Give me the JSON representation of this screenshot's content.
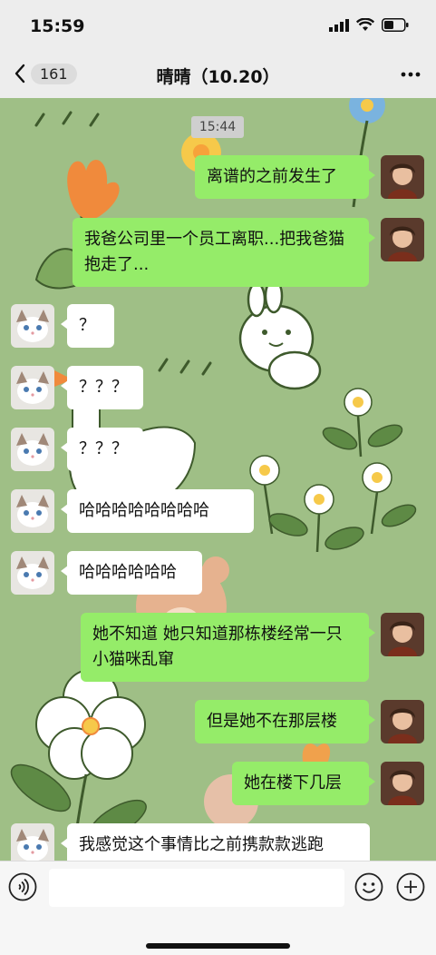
{
  "status_bar": {
    "time": "15:59"
  },
  "nav": {
    "back_count": "161",
    "title": "晴晴（10.20）"
  },
  "chat": {
    "timestamp": "15:44",
    "messages": [
      {
        "from": "me",
        "text": "离谱的之前发生了"
      },
      {
        "from": "me",
        "text": "我爸公司里一个员工离职...把我爸猫抱走了..."
      },
      {
        "from": "friend",
        "text": "？"
      },
      {
        "from": "friend",
        "text": "？？？"
      },
      {
        "from": "friend",
        "text": "？？？"
      },
      {
        "from": "friend",
        "text": "哈哈哈哈哈哈哈哈"
      },
      {
        "from": "friend",
        "text": "哈哈哈哈哈哈"
      },
      {
        "from": "me",
        "text": "她不知道 她只知道那栋楼经常一只小猫咪乱窜"
      },
      {
        "from": "me",
        "text": "但是她不在那层楼"
      },
      {
        "from": "me",
        "text": "她在楼下几层"
      },
      {
        "from": "friend",
        "text": "我感觉这个事情比之前携款款逃跑"
      }
    ]
  },
  "input_bar": {
    "placeholder": ""
  },
  "colors": {
    "chat_background": "#9fbf86",
    "outgoing_bubble": "#95ec69",
    "incoming_bubble": "#ffffff",
    "bar_background": "#ededed"
  }
}
